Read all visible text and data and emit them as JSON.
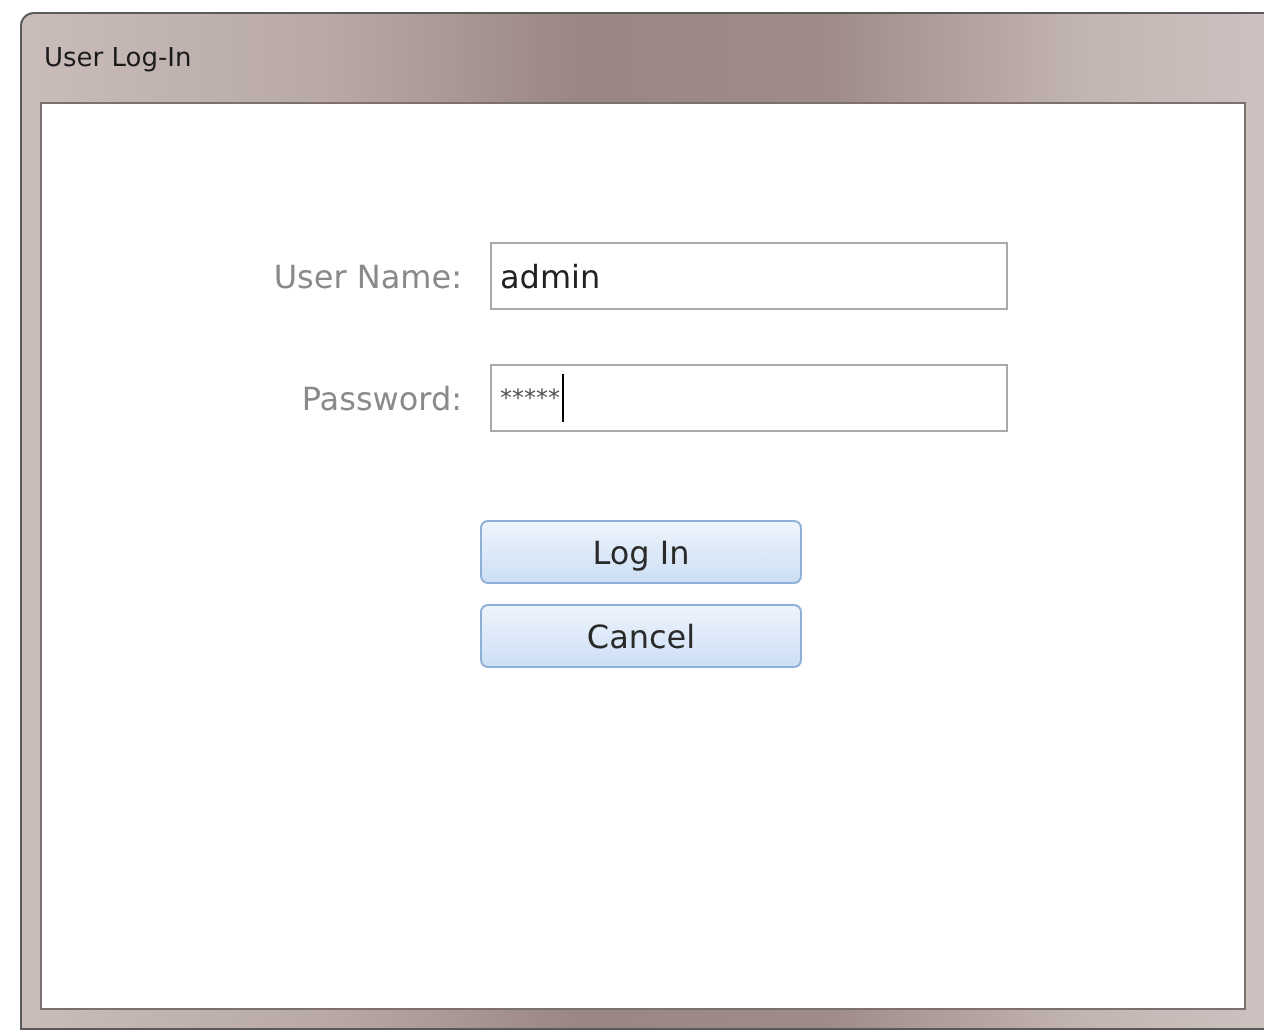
{
  "window": {
    "title": "User Log-In"
  },
  "fields": [
    {
      "label": "User Name:",
      "value": "admin",
      "focused": false
    },
    {
      "label": "Password:",
      "value": "*****",
      "focused": true
    }
  ],
  "buttons": [
    "Log In",
    "Cancel"
  ]
}
